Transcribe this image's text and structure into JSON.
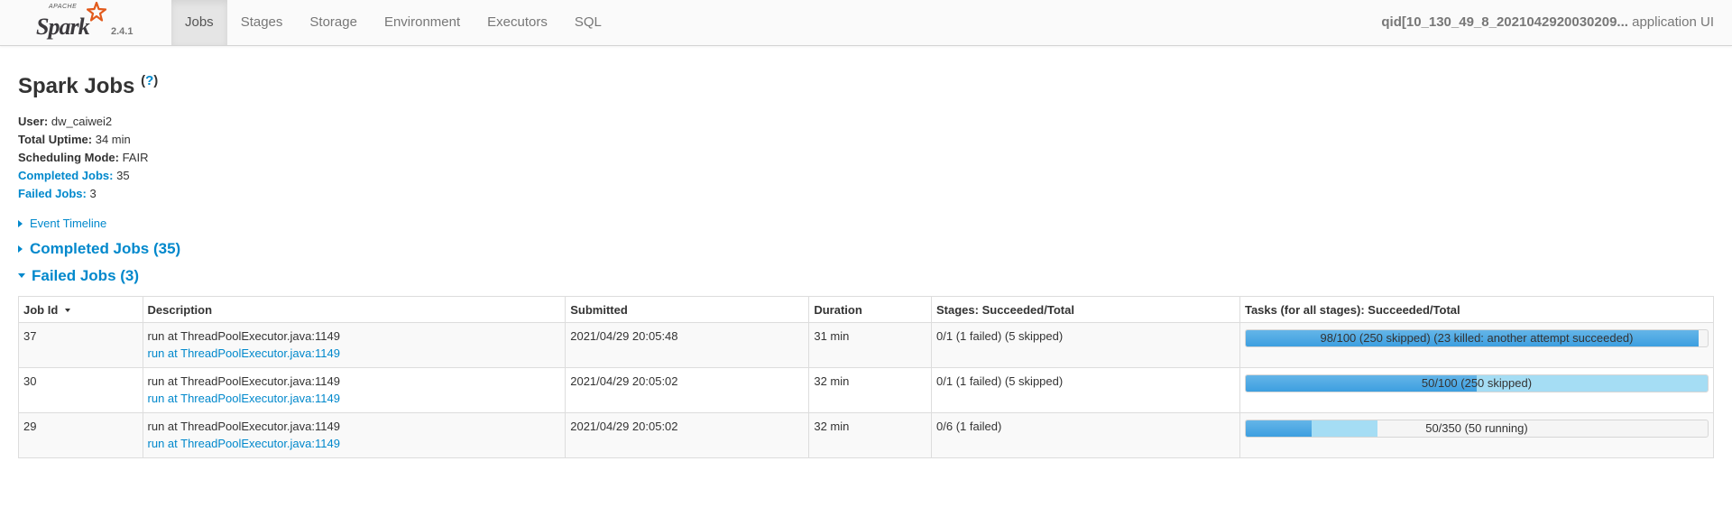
{
  "navbar": {
    "brand_apache": "APACHE",
    "brand_name": "Spark",
    "version": "2.4.1",
    "tabs": [
      "Jobs",
      "Stages",
      "Storage",
      "Environment",
      "Executors",
      "SQL"
    ],
    "active_tab": "Jobs",
    "app_name": "qid[10_130_49_8_2021042920030209...",
    "app_suffix": " application UI"
  },
  "page": {
    "title": "Spark Jobs",
    "help": "?"
  },
  "summary": {
    "user_label": "User:",
    "user": "dw_caiwei2",
    "uptime_label": "Total Uptime:",
    "uptime": "34 min",
    "mode_label": "Scheduling Mode:",
    "mode": "FAIR",
    "completed_label": "Completed Jobs:",
    "completed": "35",
    "failed_label": "Failed Jobs:",
    "failed": "3"
  },
  "timeline": {
    "label": "Event Timeline"
  },
  "sections": {
    "completed": "Completed Jobs (35)",
    "failed": "Failed Jobs (3)"
  },
  "table": {
    "headers": {
      "job_id": "Job Id",
      "description": "Description",
      "submitted": "Submitted",
      "duration": "Duration",
      "stages": "Stages: Succeeded/Total",
      "tasks": "Tasks (for all stages): Succeeded/Total"
    },
    "rows": [
      {
        "id": "37",
        "desc": "run at ThreadPoolExecutor.java:1149",
        "desc_link": "run at ThreadPoolExecutor.java:1149",
        "submitted": "2021/04/29 20:05:48",
        "duration": "31 min",
        "stages": "0/1 (1 failed) (5 skipped)",
        "tasks": "98/100 (250 skipped) (23 killed: another attempt succeeded)",
        "done_fraction": 0.98,
        "running_fraction": 0.0
      },
      {
        "id": "30",
        "desc": "run at ThreadPoolExecutor.java:1149",
        "desc_link": "run at ThreadPoolExecutor.java:1149",
        "submitted": "2021/04/29 20:05:02",
        "duration": "32 min",
        "stages": "0/1 (1 failed) (5 skipped)",
        "tasks": "50/100 (250 skipped)",
        "done_fraction": 0.5,
        "running_fraction": 0.5
      },
      {
        "id": "29",
        "desc": "run at ThreadPoolExecutor.java:1149",
        "desc_link": "run at ThreadPoolExecutor.java:1149",
        "submitted": "2021/04/29 20:05:02",
        "duration": "32 min",
        "stages": "0/6 (1 failed)",
        "tasks": "50/350 (50 running)",
        "done_fraction": 0.143,
        "running_fraction": 0.143
      }
    ]
  },
  "colors": {
    "link": "#0088cc",
    "progress_done": "#3d9fe0",
    "progress_running": "#a5ddf4"
  }
}
